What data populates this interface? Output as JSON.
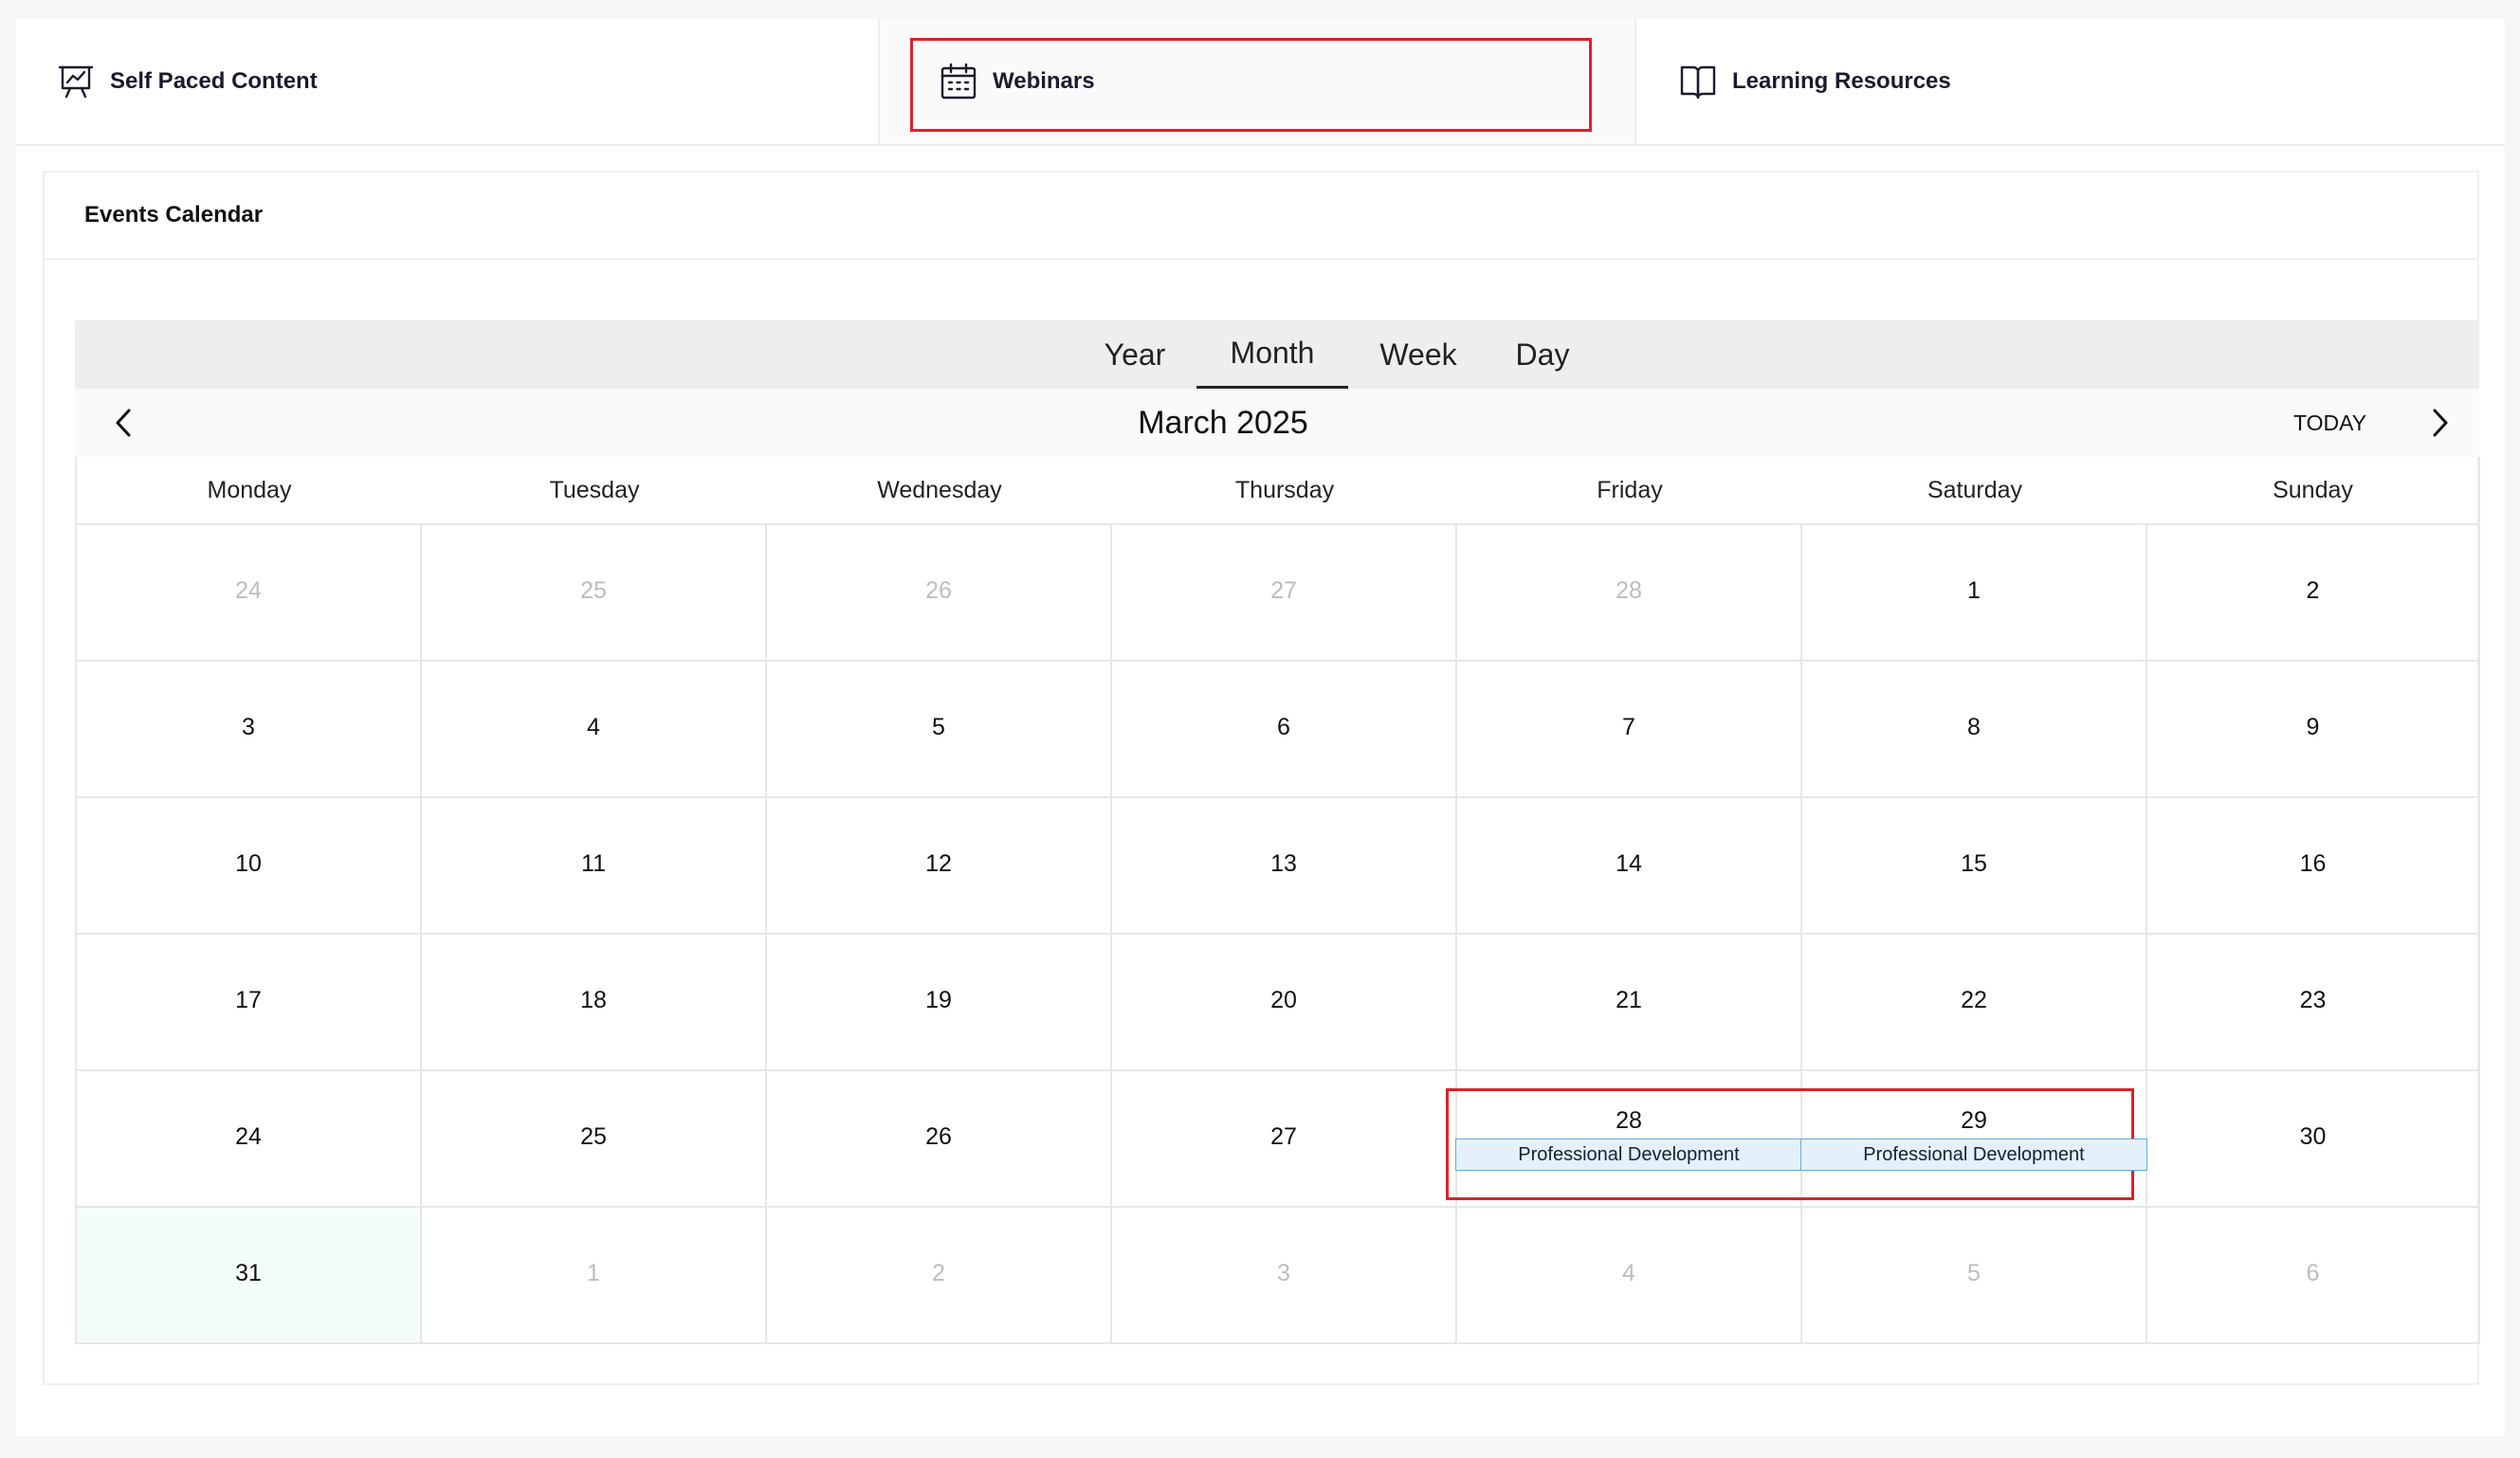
{
  "tabs": [
    {
      "label": "Self Paced Content",
      "icon": "presentation-chart-icon"
    },
    {
      "label": "Webinars",
      "icon": "calendar-icon"
    },
    {
      "label": "Learning Resources",
      "icon": "open-book-icon"
    }
  ],
  "card": {
    "title": "Events Calendar"
  },
  "views": [
    "Year",
    "Month",
    "Week",
    "Day"
  ],
  "active_view": "Month",
  "nav": {
    "title": "March 2025",
    "today_label": "TODAY"
  },
  "weekdays": [
    "Monday",
    "Tuesday",
    "Wednesday",
    "Thursday",
    "Friday",
    "Saturday",
    "Sunday"
  ],
  "weeks": [
    [
      {
        "d": "24",
        "o": true
      },
      {
        "d": "25",
        "o": true
      },
      {
        "d": "26",
        "o": true
      },
      {
        "d": "27",
        "o": true
      },
      {
        "d": "28",
        "o": true
      },
      {
        "d": "1"
      },
      {
        "d": "2"
      }
    ],
    [
      {
        "d": "3"
      },
      {
        "d": "4"
      },
      {
        "d": "5"
      },
      {
        "d": "6"
      },
      {
        "d": "7"
      },
      {
        "d": "8"
      },
      {
        "d": "9"
      }
    ],
    [
      {
        "d": "10"
      },
      {
        "d": "11"
      },
      {
        "d": "12"
      },
      {
        "d": "13"
      },
      {
        "d": "14"
      },
      {
        "d": "15"
      },
      {
        "d": "16"
      }
    ],
    [
      {
        "d": "17"
      },
      {
        "d": "18"
      },
      {
        "d": "19"
      },
      {
        "d": "20"
      },
      {
        "d": "21"
      },
      {
        "d": "22"
      },
      {
        "d": "23"
      }
    ],
    [
      {
        "d": "24"
      },
      {
        "d": "25"
      },
      {
        "d": "26"
      },
      {
        "d": "27"
      },
      {
        "d": "28"
      },
      {
        "d": "29"
      },
      {
        "d": "30"
      }
    ],
    [
      {
        "d": "31",
        "today": true
      },
      {
        "d": "1",
        "o": true
      },
      {
        "d": "2",
        "o": true
      },
      {
        "d": "3",
        "o": true
      },
      {
        "d": "4",
        "o": true
      },
      {
        "d": "5",
        "o": true
      },
      {
        "d": "6",
        "o": true
      }
    ]
  ],
  "events": [
    {
      "label": "Professional Development",
      "week": 4,
      "day": 4
    },
    {
      "label": "Professional Development",
      "week": 4,
      "day": 5
    }
  ],
  "colors": {
    "highlight": "#e0202a",
    "event_bg": "#e4f1fb",
    "event_border": "#5aaedc",
    "today_bg": "#f5fdf8"
  }
}
